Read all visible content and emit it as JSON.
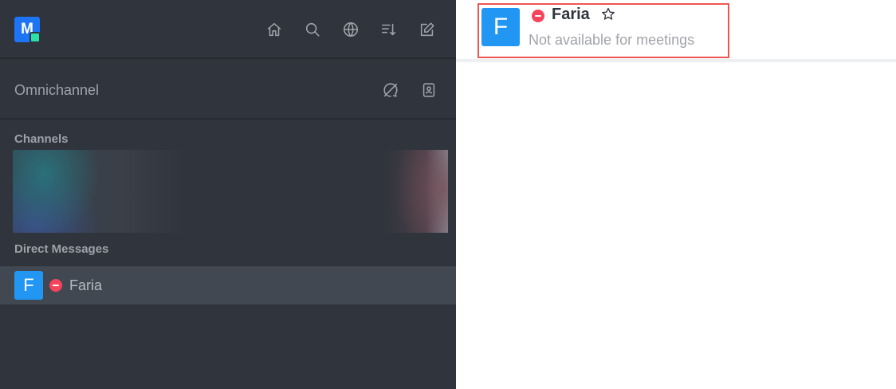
{
  "user": {
    "initial": "M",
    "status_color": "#2de0a5"
  },
  "header_icons": [
    "home-icon",
    "search-icon",
    "directory-globe-icon",
    "sort-icon",
    "create-new-icon"
  ],
  "omnichannel": {
    "title": "Omnichannel",
    "icons": [
      "omnichannel-offline-icon",
      "contact-center-icon"
    ]
  },
  "sidebar": {
    "channels_title": "Channels",
    "direct_messages_title": "Direct Messages",
    "direct_messages": [
      {
        "initial": "F",
        "name": "Faria",
        "status": "busy"
      }
    ]
  },
  "room": {
    "initial": "F",
    "name": "Faria",
    "status": "busy",
    "topic": "Not available for meetings"
  },
  "colors": {
    "sidebar_bg": "#2f343d",
    "selected_row": "#414852",
    "avatar_blue": "#2196f3",
    "busy_red": "#f5455c",
    "highlight": "#ef5552"
  }
}
